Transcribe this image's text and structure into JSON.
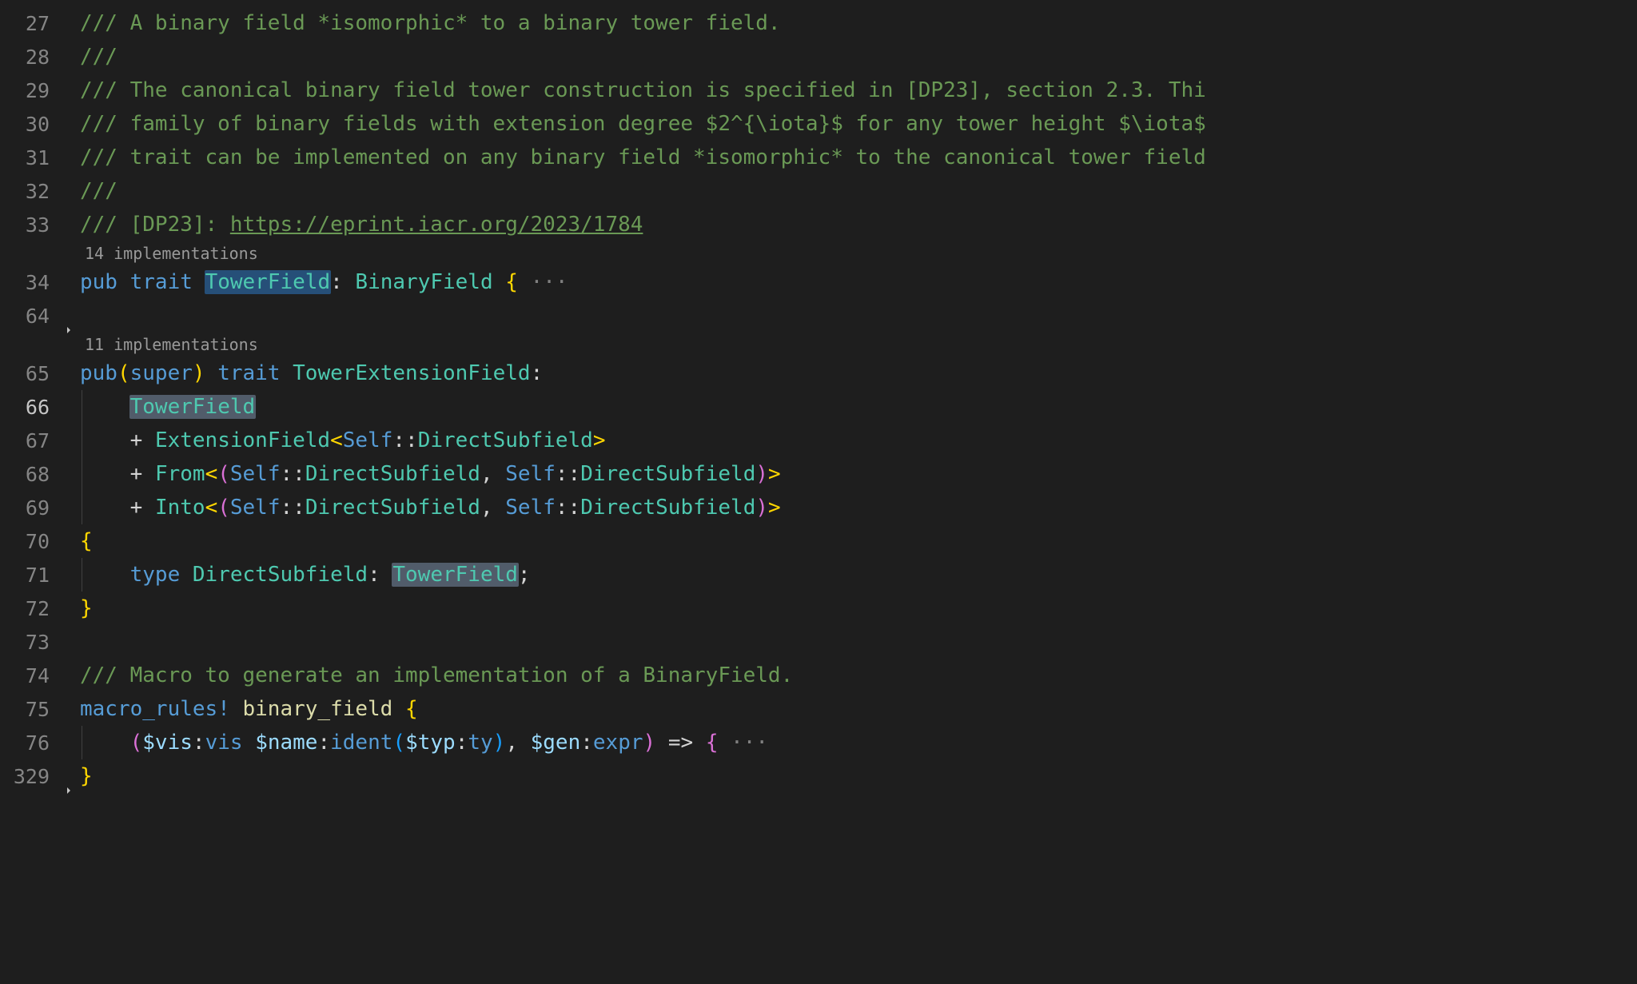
{
  "gutter": {
    "l27": "27",
    "l28": "28",
    "l29": "29",
    "l30": "30",
    "l31": "31",
    "l32": "32",
    "l33": "33",
    "l34": "34",
    "l64": "64",
    "l65": "65",
    "l66": "66",
    "l67": "67",
    "l68": "68",
    "l69": "69",
    "l70": "70",
    "l71": "71",
    "l72": "72",
    "l73": "73",
    "l74": "74",
    "l75": "75",
    "l76": "76",
    "l329": "329"
  },
  "codelens": {
    "impl14": "14 implementations",
    "impl11": "11 implementations"
  },
  "line27": {
    "t": "/// A binary field *isomorphic* to a binary tower field."
  },
  "line28": {
    "t": "///"
  },
  "line29": {
    "t": "/// The canonical binary field tower construction is specified in [DP23], section 2.3. Thi"
  },
  "line30": {
    "t": "/// family of binary fields with extension degree $2^{\\iota}$ for any tower height $\\iota$"
  },
  "line31": {
    "t": "/// trait can be implemented on any binary field *isomorphic* to the canonical tower field"
  },
  "line32": {
    "t": "///"
  },
  "line33": {
    "pre": "/// [DP23]: ",
    "link": "https://eprint.iacr.org/2023/1784"
  },
  "line34": {
    "pub": "pub",
    "sp1": " ",
    "trait": "trait",
    "sp2": " ",
    "name": "TowerField",
    "punct1": ":",
    "sp3": " ",
    "base": "BinaryField",
    "sp4": " ",
    "lb": "{",
    "dots": " ···"
  },
  "line65": {
    "pub": "pub",
    "lp": "(",
    "super": "super",
    "rp": ")",
    "sp1": " ",
    "trait": "trait",
    "sp2": " ",
    "name": "TowerExtensionField",
    "colon": ":"
  },
  "line66": {
    "indent": "    ",
    "name": "TowerField"
  },
  "line67": {
    "indent": "    ",
    "plus": "+ ",
    "ext": "ExtensionField",
    "lt": "<",
    "self1": "Self",
    "d1": "::",
    "dsf1": "DirectSubfield",
    "gt": ">"
  },
  "line68": {
    "indent": "    ",
    "plus": "+ ",
    "from": "From",
    "lt": "<",
    "lp": "(",
    "self1": "Self",
    "d1": "::",
    "dsf1": "DirectSubfield",
    "comma": ", ",
    "self2": "Self",
    "d2": "::",
    "dsf2": "DirectSubfield",
    "rp": ")",
    "gt": ">"
  },
  "line69": {
    "indent": "    ",
    "plus": "+ ",
    "into": "Into",
    "lt": "<",
    "lp": "(",
    "self1": "Self",
    "d1": "::",
    "dsf1": "DirectSubfield",
    "comma": ", ",
    "self2": "Self",
    "d2": "::",
    "dsf2": "DirectSubfield",
    "rp": ")",
    "gt": ">"
  },
  "line70": {
    "lb": "{"
  },
  "line71": {
    "indent": "    ",
    "typekw": "type",
    "sp": " ",
    "name": "DirectSubfield",
    "colon": ": ",
    "bound": "TowerField",
    "semi": ";"
  },
  "line72": {
    "rb": "}"
  },
  "line74": {
    "t": "/// Macro to generate an implementation of a BinaryField."
  },
  "line75": {
    "mr": "macro_rules!",
    "sp": " ",
    "name": "binary_field",
    "sp2": " ",
    "lb": "{"
  },
  "line76": {
    "indent": "    ",
    "lp": "(",
    "dvis": "$vis",
    "c1": ":",
    "vis": "vis",
    "sp1": " ",
    "dname": "$name",
    "c2": ":",
    "ident": "ident",
    "lp2": "(",
    "dtyp": "$typ",
    "c3": ":",
    "ty": "ty",
    "rp2": ")",
    "comma": ", ",
    "dgen": "$gen",
    "c4": ":",
    "expr": "expr",
    "rp": ")",
    "sp2": " ",
    "arrow": "=>",
    "sp3": " ",
    "lb": "{",
    "dots": " ···"
  },
  "line329": {
    "rb": "}"
  }
}
